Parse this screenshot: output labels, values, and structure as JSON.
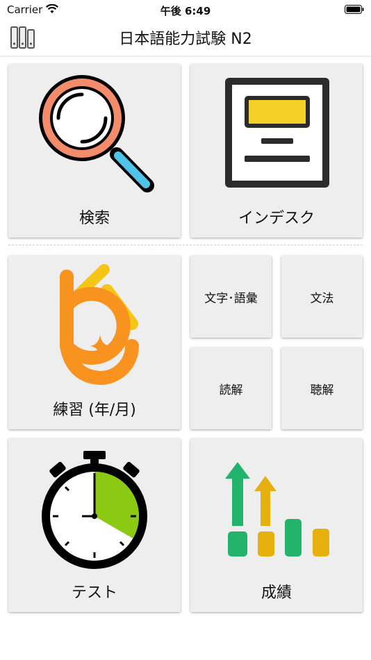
{
  "status_bar": {
    "carrier": "Carrier",
    "time": "午後 6:49",
    "battery_icon": "battery-full-icon",
    "wifi_icon": "wifi-icon"
  },
  "nav": {
    "title": "日本語能力試験 N2",
    "menu_icon": "bookshelf-icon"
  },
  "tiles": {
    "search": {
      "label": "検索",
      "icon": "magnifier-icon"
    },
    "index": {
      "label": "インデスク",
      "icon": "document-icon"
    },
    "practice": {
      "label": "練習 (年/月)",
      "icon": "practice-logo-icon"
    },
    "vocab": {
      "label": "文字･語彙"
    },
    "grammar": {
      "label": "文法"
    },
    "reading": {
      "label": "読解"
    },
    "listening": {
      "label": "聴解"
    },
    "test": {
      "label": "テスト",
      "icon": "stopwatch-icon"
    },
    "results": {
      "label": "成績",
      "icon": "growth-chart-icon"
    }
  },
  "colors": {
    "tile_bg": "#eeeeee",
    "accent_orange": "#f7931e",
    "accent_yellow": "#f5c518",
    "green": "#24b36b",
    "gold": "#e6b00e"
  }
}
